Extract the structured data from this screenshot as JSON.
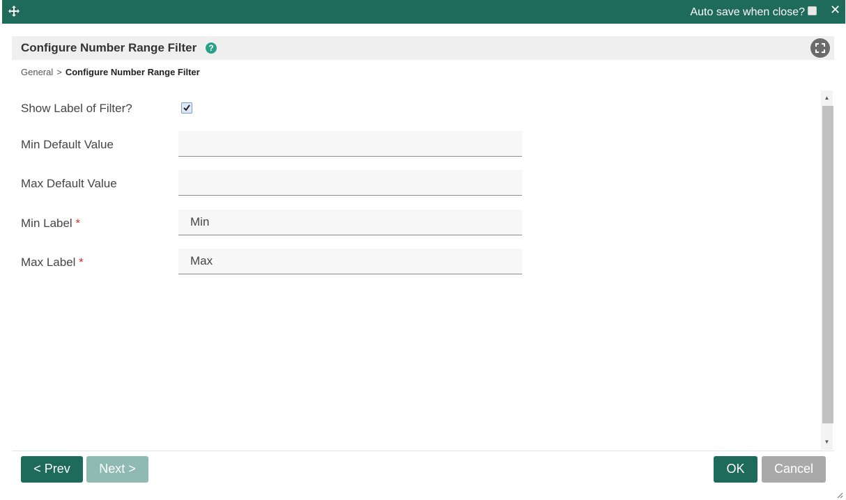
{
  "titlebar": {
    "autosave_label": "Auto save when close?",
    "autosave_checked": false,
    "close_icon": "close-icon",
    "move_icon": "move-icon",
    "color": "#1f6b5b"
  },
  "header": {
    "title": "Configure Number Range Filter",
    "help_icon": "?",
    "fullscreen_icon": "fullscreen-icon"
  },
  "breadcrumb": {
    "parent": "General",
    "separator": ">",
    "current": "Configure Number Range Filter"
  },
  "form": {
    "show_label": {
      "label": "Show Label of Filter?",
      "checked": true
    },
    "min_default": {
      "label": "Min Default Value",
      "value": ""
    },
    "max_default": {
      "label": "Max Default Value",
      "value": ""
    },
    "min_label": {
      "label": "Min Label",
      "required": "*",
      "value": "Min"
    },
    "max_label": {
      "label": "Max Label",
      "required": "*",
      "value": "Max"
    }
  },
  "footer": {
    "prev_label": "< Prev",
    "next_label": "Next >",
    "ok_label": "OK",
    "cancel_label": "Cancel"
  },
  "colors": {
    "accent": "#1f6b5b",
    "help": "#2aa287",
    "required": "#d9302c",
    "disabled": "#8fbab1"
  }
}
